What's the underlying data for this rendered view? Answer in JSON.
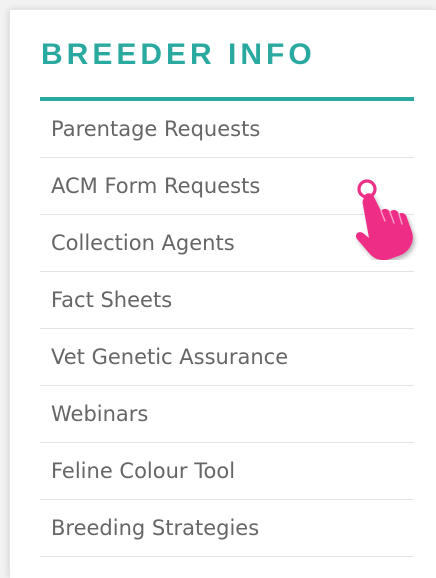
{
  "sidebar": {
    "heading": "BREEDER INFO",
    "items": [
      {
        "label": "Parentage Requests"
      },
      {
        "label": "ACM Form Requests"
      },
      {
        "label": "Collection Agents"
      },
      {
        "label": "Fact Sheets"
      },
      {
        "label": "Vet Genetic Assurance"
      },
      {
        "label": "Webinars"
      },
      {
        "label": "Feline Colour Tool"
      },
      {
        "label": "Breeding Strategies"
      }
    ]
  },
  "colors": {
    "accent": "#2aa9a0",
    "text": "#666666",
    "divider": "#e3e3e3",
    "pointer": "#ee2f86"
  },
  "icons": {
    "cursor": "hand-pointer-icon"
  }
}
